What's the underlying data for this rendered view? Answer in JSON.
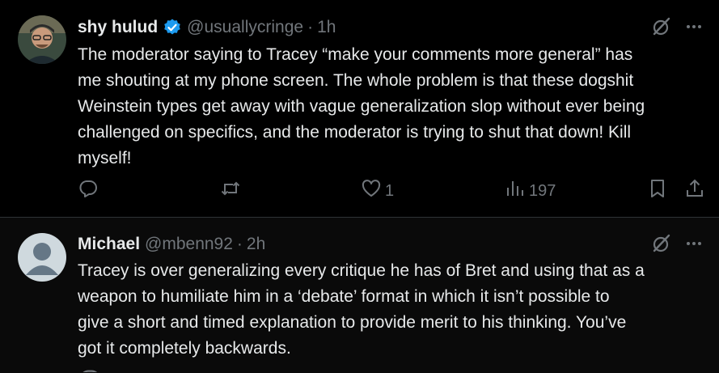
{
  "posts": [
    {
      "name": "shy hulud",
      "verified": true,
      "handle": "@usuallycringe",
      "separator": "·",
      "time": "1h",
      "text": "The moderator saying to Tracey “make your comments more general” has\nme shouting at my phone screen. The whole problem is that these dogshit\nWeinstein types get away with vague generalization slop without ever being\nchallenged on specifics, and the moderator is trying to shut that down! Kill\nmyself!",
      "like_count": "1",
      "view_count": "197"
    },
    {
      "name": "Michael",
      "handle": "@mbenn92",
      "separator": "·",
      "time": "2h",
      "text": "Tracey is over generalizing every critique he has of Bret and using that as a\nweapon to humiliate him in a ‘debate’ format in which it isn’t possible to\ngive a short and timed explanation to provide merit to his thinking. You’ve\ngot it completely backwards."
    }
  ],
  "icons": {
    "verified_color": "#1d9bf0",
    "action_color": "#71767b"
  }
}
